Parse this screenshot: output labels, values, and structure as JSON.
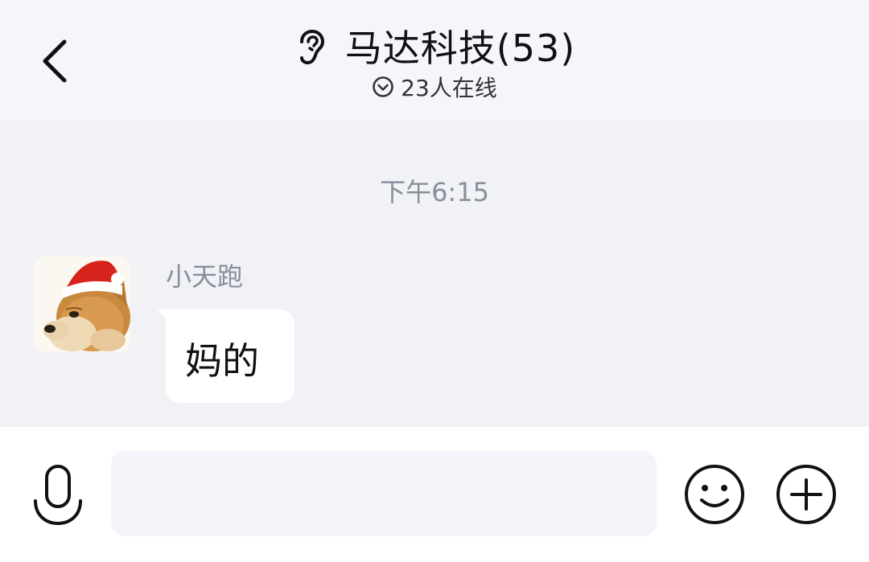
{
  "header": {
    "back_icon": "chevron-left-icon",
    "ear_icon": "ear-icon",
    "title": "马达科技(53)",
    "status_icon": "chevron-down-circle-icon",
    "status_text": "23人在线"
  },
  "chat": {
    "timestamp": "下午6:15",
    "messages": [
      {
        "sender": "小天跑",
        "avatar": "shiba-dog-santa-hat-avatar",
        "text": "妈的"
      }
    ]
  },
  "input_bar": {
    "voice_icon": "microphone-icon",
    "input_value": "",
    "input_placeholder": "",
    "emoji_icon": "smiley-face-icon",
    "more_icon": "plus-circle-icon"
  },
  "colors": {
    "header_bg": "#f5f6fb",
    "chat_bg": "#f1f2f6",
    "bubble_bg": "#ffffff",
    "muted_text": "#8a8e9c",
    "input_bg": "#f4f5fb"
  }
}
